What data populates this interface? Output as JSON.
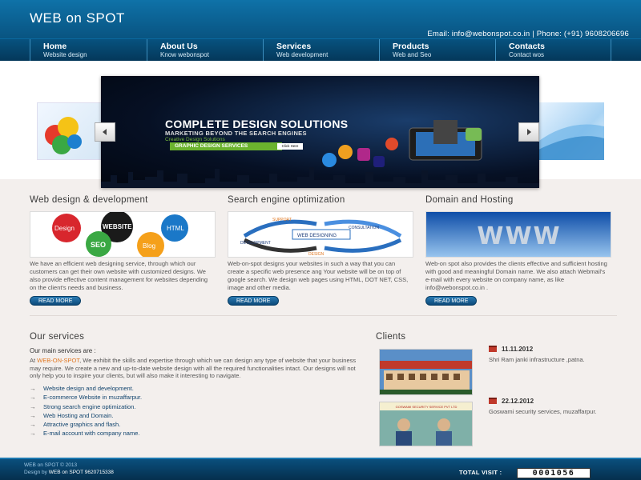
{
  "header": {
    "logo": "WEB on SPOT",
    "contact": "Email: info@webonspot.co.in  |  Phone: (+91) 9608206696"
  },
  "nav": [
    {
      "title": "Home",
      "sub": "Website design"
    },
    {
      "title": "About Us",
      "sub": "Know webonspot"
    },
    {
      "title": "Services",
      "sub": "Web development"
    },
    {
      "title": "Products",
      "sub": "Web and Seo"
    },
    {
      "title": "Contacts",
      "sub": "Contact wos"
    }
  ],
  "slider": {
    "heading": "COMPLETE DESIGN SOLUTIONS",
    "subheading": "MARKETING BEYOND THE SEARCH ENGINES",
    "tagline": "Creative Design Solutions",
    "bar_text": "GRAPHIC DESIGN SERVICES",
    "click": "Click Here"
  },
  "features": [
    {
      "title": "Web design & development",
      "text": "We have an efficient web designing service, through which our customers can get their own website with customized designs. We also provide effective content management for websites depending on the client's needs and business.",
      "button": "READ MORE",
      "image_words": [
        "Design",
        "WEBSITE",
        "HTML",
        "SEO",
        "Blog"
      ]
    },
    {
      "title": "Search engine optimization",
      "text": "Web-on-spot designs your websites in such a way that you can create a specific web presence ang Your website will be on top of google search. We design web pages using HTML, DOT NET, CSS, image and other media.",
      "button": "READ MORE",
      "image_words": [
        "SUPPORT",
        "CONSULTATION",
        "WEB DESIGNING",
        "DEVELOPMENT",
        "DESIGN"
      ]
    },
    {
      "title": "Domain and Hosting",
      "text": "Web-on spot also provides the clients effective and sufficient hosting with good and meaningful Domain name. We also attach Webmail's e-mail with every website on company name, as like info@webonspot.co.in .",
      "button": "READ MORE",
      "image_words": [
        "WWW"
      ]
    }
  ],
  "services": {
    "title": "Our services",
    "subtitle": "Our main services are :",
    "intro_prefix": "At ",
    "intro_brand": "WEB-ON-SPOT",
    "intro_rest": ", We exhibit the skills and expertise through which we can design any type of website that your business may require. We create a new and up-to-date website design with all the required functionalities intact. Our designs will not only help you to inspire your clients, but will also make it interesting to navigate.",
    "items": [
      "Website design and development.",
      "E-commerce Website in muzaffarpur.",
      "Strong search engine optimization.",
      "Web Hosting and Domain.",
      "Attractive graphics and flash.",
      "E-mail account with company name."
    ]
  },
  "clients": {
    "title": "Clients",
    "entries": [
      {
        "date": "11.11.2012",
        "desc": "Shri Ram janki infrastructure ,patna."
      },
      {
        "date": "22.12.2012",
        "desc": "Goswami security services, muzaffarpur."
      }
    ],
    "client2_banner": "GOSWAMI SECURITY SERVICE PVT LTD"
  },
  "footer": {
    "copyright": "WEB on SPOT © 2013",
    "design_prefix": "Design by",
    "design_name": "WEB on SPOT 9620715338",
    "visit_label": "TOTAL VISIT :",
    "visit_count": "0001056"
  },
  "colors": {
    "header_blue": "#0a5c8c",
    "accent_orange": "#e0761f",
    "link_blue": "#11446e"
  }
}
